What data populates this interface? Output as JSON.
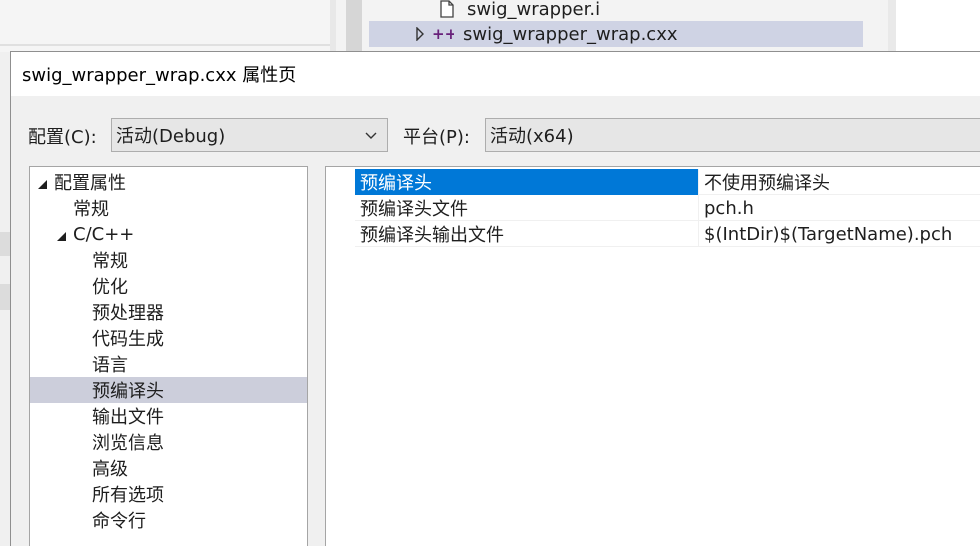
{
  "solution_explorer": {
    "items": [
      {
        "label": "swig_wrapper.i",
        "icon": "file-icon"
      },
      {
        "label": "swig_wrapper_wrap.cxx",
        "icon": "cpp-file-icon",
        "expand": "collapsed"
      }
    ],
    "selected_row_color": "#cfd3e4"
  },
  "dialog": {
    "title": "swig_wrapper_wrap.cxx 属性页",
    "config_label": "配置(C):",
    "config_value": "活动(Debug)",
    "platform_label": "平台(P):",
    "platform_value": "活动(x64)"
  },
  "tree": {
    "items": [
      {
        "label": "配置属性",
        "level": 0,
        "expand": "expanded"
      },
      {
        "label": "常规",
        "level": 1
      },
      {
        "label": "C/C++",
        "level": 1,
        "expand": "expanded"
      },
      {
        "label": "常规",
        "level": 2
      },
      {
        "label": "优化",
        "level": 2
      },
      {
        "label": "预处理器",
        "level": 2
      },
      {
        "label": "代码生成",
        "level": 2
      },
      {
        "label": "语言",
        "level": 2
      },
      {
        "label": "预编译头",
        "level": 2,
        "selected": true
      },
      {
        "label": "输出文件",
        "level": 2
      },
      {
        "label": "浏览信息",
        "level": 2
      },
      {
        "label": "高级",
        "level": 2
      },
      {
        "label": "所有选项",
        "level": 2
      },
      {
        "label": "命令行",
        "level": 2
      }
    ],
    "selected_color": "#cccedb"
  },
  "properties": [
    {
      "name": "预编译头",
      "value": "不使用预编译头",
      "selected": true
    },
    {
      "name": "预编译头文件",
      "value": "pch.h"
    },
    {
      "name": "预编译头输出文件",
      "value": "$(IntDir)$(TargetName).pch"
    }
  ],
  "accent_color": "#0078d7"
}
